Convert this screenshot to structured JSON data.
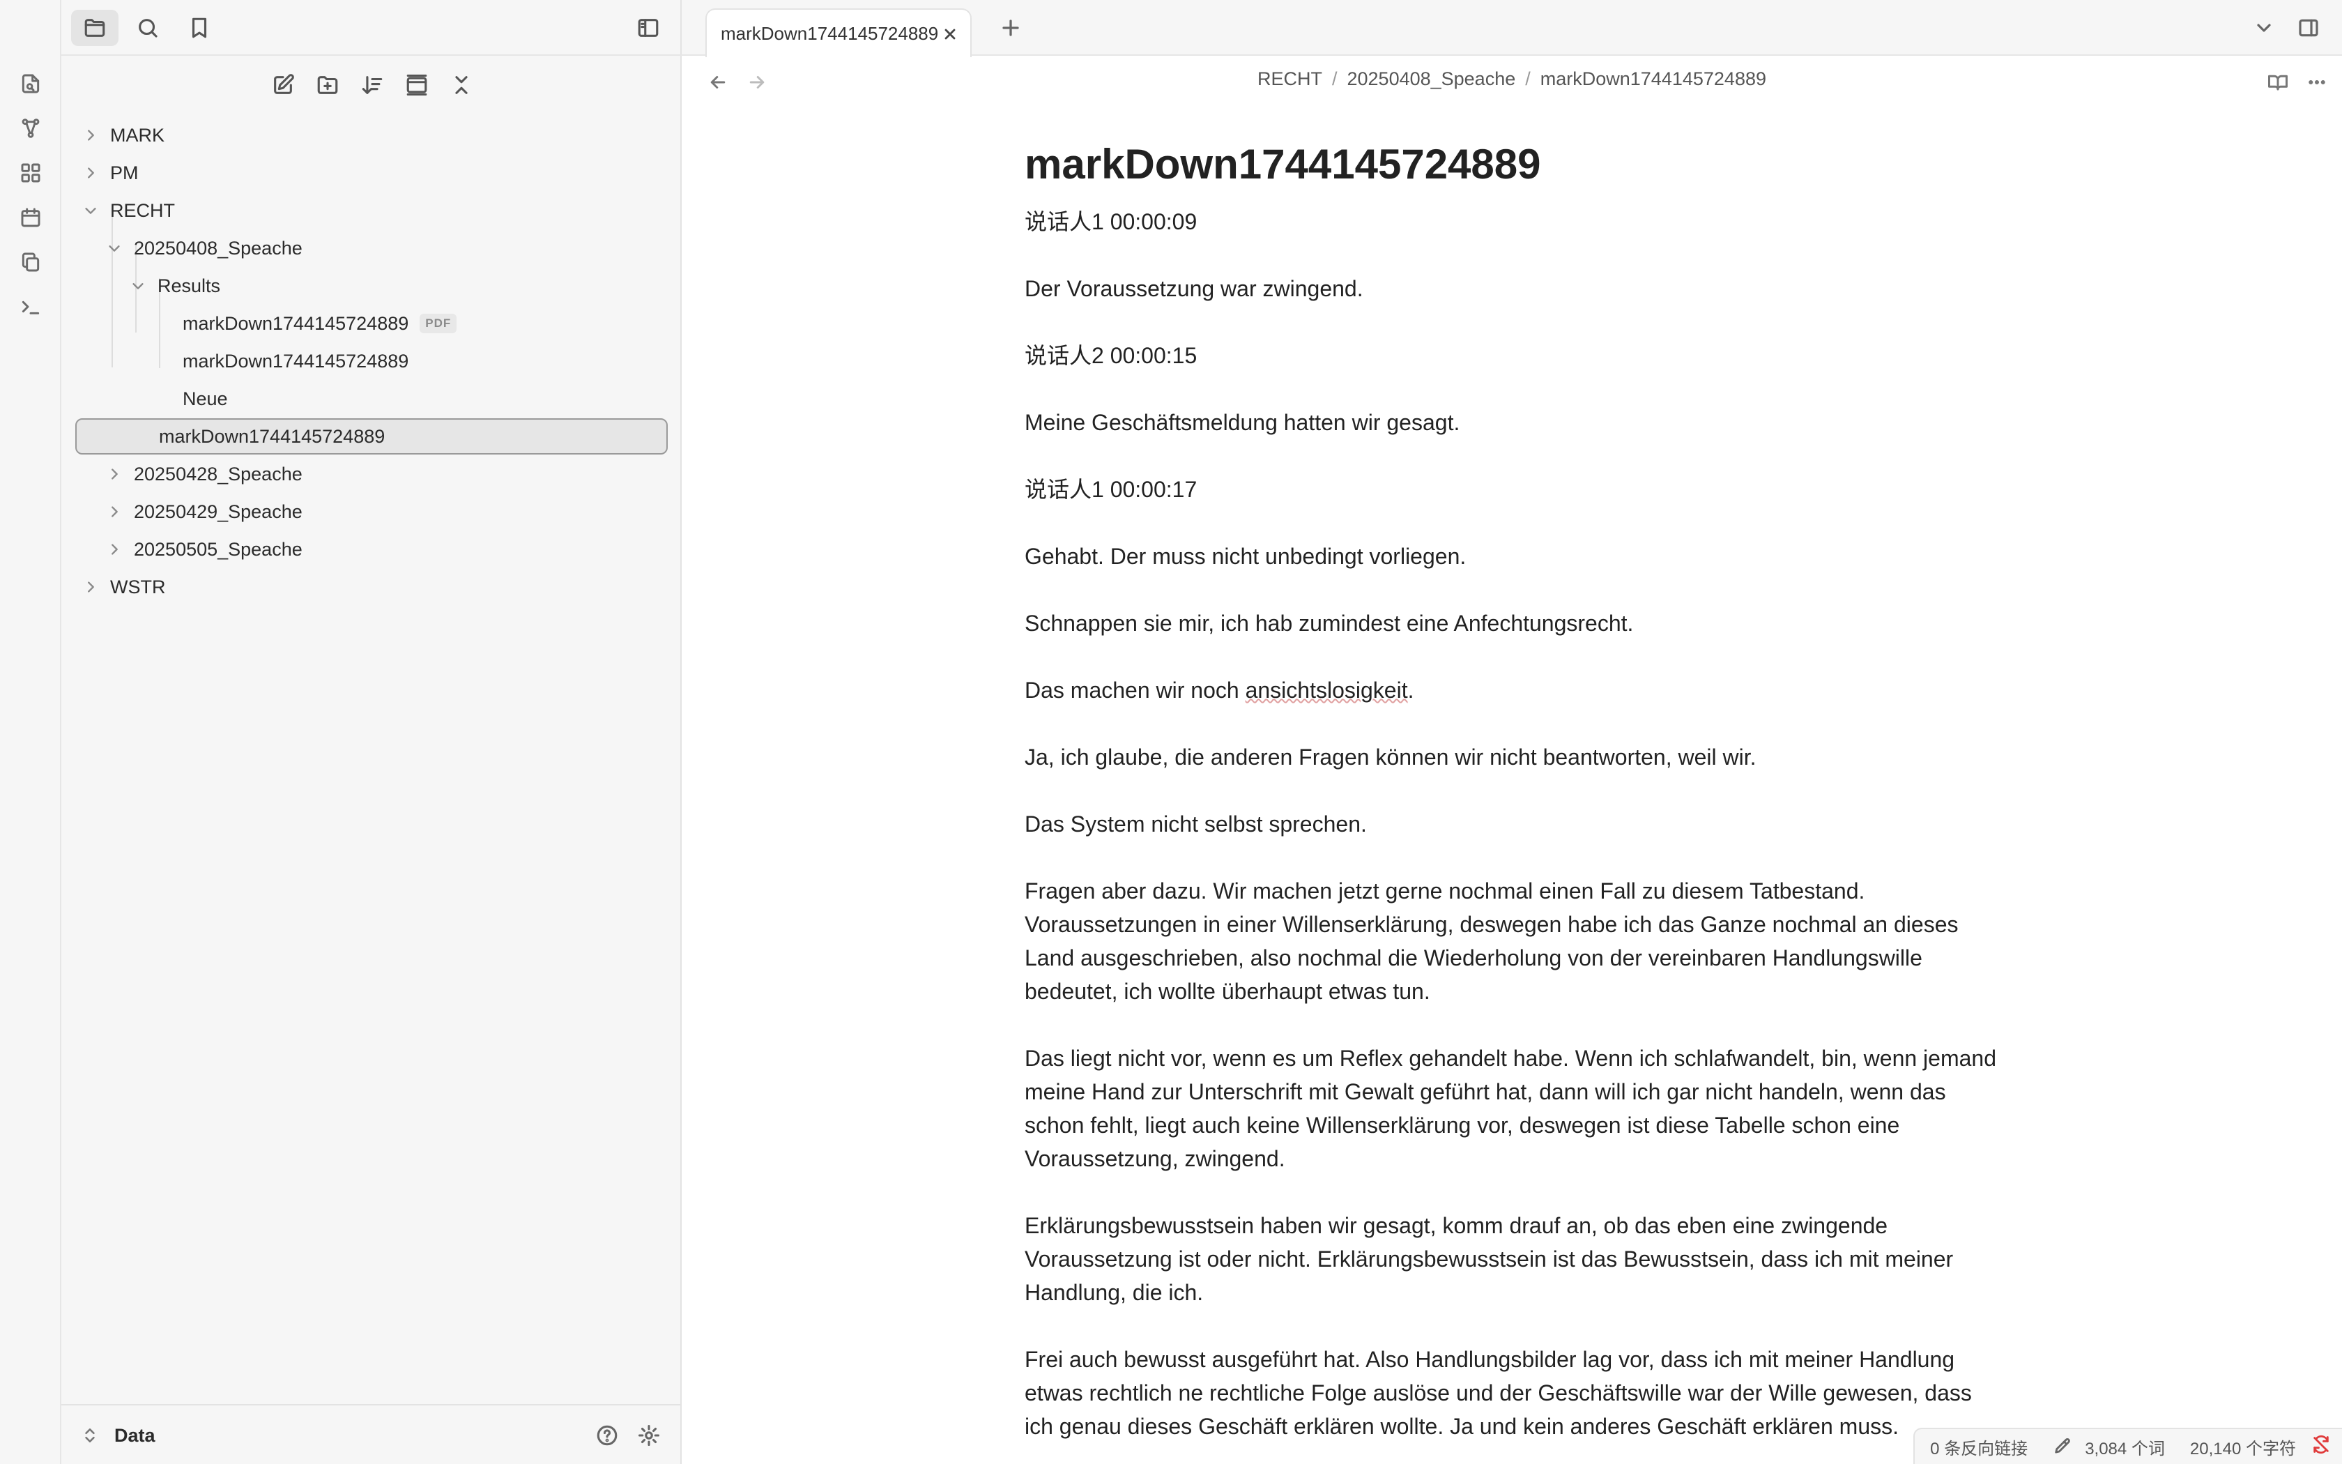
{
  "sidebar": {
    "tree": [
      {
        "label": "MARK",
        "depth": 0,
        "expanded": false
      },
      {
        "label": "PM",
        "depth": 0,
        "expanded": false
      },
      {
        "label": "RECHT",
        "depth": 0,
        "expanded": true
      },
      {
        "label": "20250408_Speache",
        "depth": 1,
        "expanded": true
      },
      {
        "label": "Results",
        "depth": 2,
        "expanded": true
      },
      {
        "label": "markDown1744145724889",
        "depth": 3,
        "badge": "PDF"
      },
      {
        "label": "markDown1744145724889",
        "depth": 3
      },
      {
        "label": "Neue",
        "depth": 3
      },
      {
        "label": "markDown1744145724889",
        "depth": 2,
        "selected": true
      },
      {
        "label": "20250428_Speache",
        "depth": 1,
        "expanded": false
      },
      {
        "label": "20250429_Speache",
        "depth": 1,
        "expanded": false
      },
      {
        "label": "20250505_Speache",
        "depth": 1,
        "expanded": false
      },
      {
        "label": "WSTR",
        "depth": 0,
        "expanded": false
      }
    ],
    "vault_name": "Data"
  },
  "tabs": [
    {
      "title": "markDown1744145724889",
      "active": true
    }
  ],
  "breadcrumb": [
    "RECHT",
    "20250408_Speache",
    "markDown1744145724889"
  ],
  "breadcrumb_sep": "/",
  "document": {
    "title": "markDown1744145724889",
    "paragraphs": [
      "说话人1 00:00:09",
      "Der Voraussetzung war zwingend.",
      "说话人2 00:00:15",
      "Meine Geschäftsmeldung hatten wir gesagt.",
      "说话人1 00:00:17",
      "Gehabt. Der muss nicht unbedingt vorliegen.",
      "Schnappen sie mir, ich hab zumindest eine Anfechtungsrecht.",
      "Ja, ich glaube, die anderen Fragen können wir nicht beantworten, weil wir.",
      "Das System nicht selbst sprechen.",
      "Fragen aber dazu. Wir machen jetzt gerne nochmal einen Fall zu diesem Tatbestand. Voraussetzungen in einer Willenserklärung, deswegen habe ich das Ganze nochmal an dieses Land ausgeschrieben, also nochmal die Wiederholung von der vereinbaren Handlungswille bedeutet, ich wollte überhaupt etwas tun.",
      "Das liegt nicht vor, wenn es um Reflex gehandelt habe. Wenn ich schlafwandelt, bin, wenn jemand meine Hand zur Unterschrift mit Gewalt geführt hat, dann will ich gar nicht handeln, wenn das schon fehlt, liegt auch keine Willenserklärung vor, deswegen ist diese Tabelle schon eine Voraussetzung, zwingend.",
      "Erklärungsbewusstsein haben wir gesagt, komm drauf an, ob das eben eine zwingende Voraussetzung ist oder nicht. Erklärungsbewusstsein ist das Bewusstsein, dass ich mit meiner Handlung, die ich.",
      "Frei auch bewusst ausgeführt hat. Also Handlungsbilder lag vor, dass ich mit meiner Handlung etwas rechtlich ne rechtliche Folge auslöse und der Geschäftswille war der Wille gewesen, dass ich genau dieses Geschäft erklären wollte. Ja und kein anderes Geschäft erklären muss."
    ],
    "spellcheck_segment": {
      "paragraph_index": 7,
      "before": "Das machen wir noch ",
      "word": "ansichtslosigkeit",
      "after": "."
    }
  },
  "status": {
    "backlinks": "0 条反向链接",
    "words": "3,084 个词",
    "chars": "20,140 个字符"
  },
  "colors": {
    "sync_error": "#e03b3b",
    "selected_border": "#9a9a9a"
  }
}
